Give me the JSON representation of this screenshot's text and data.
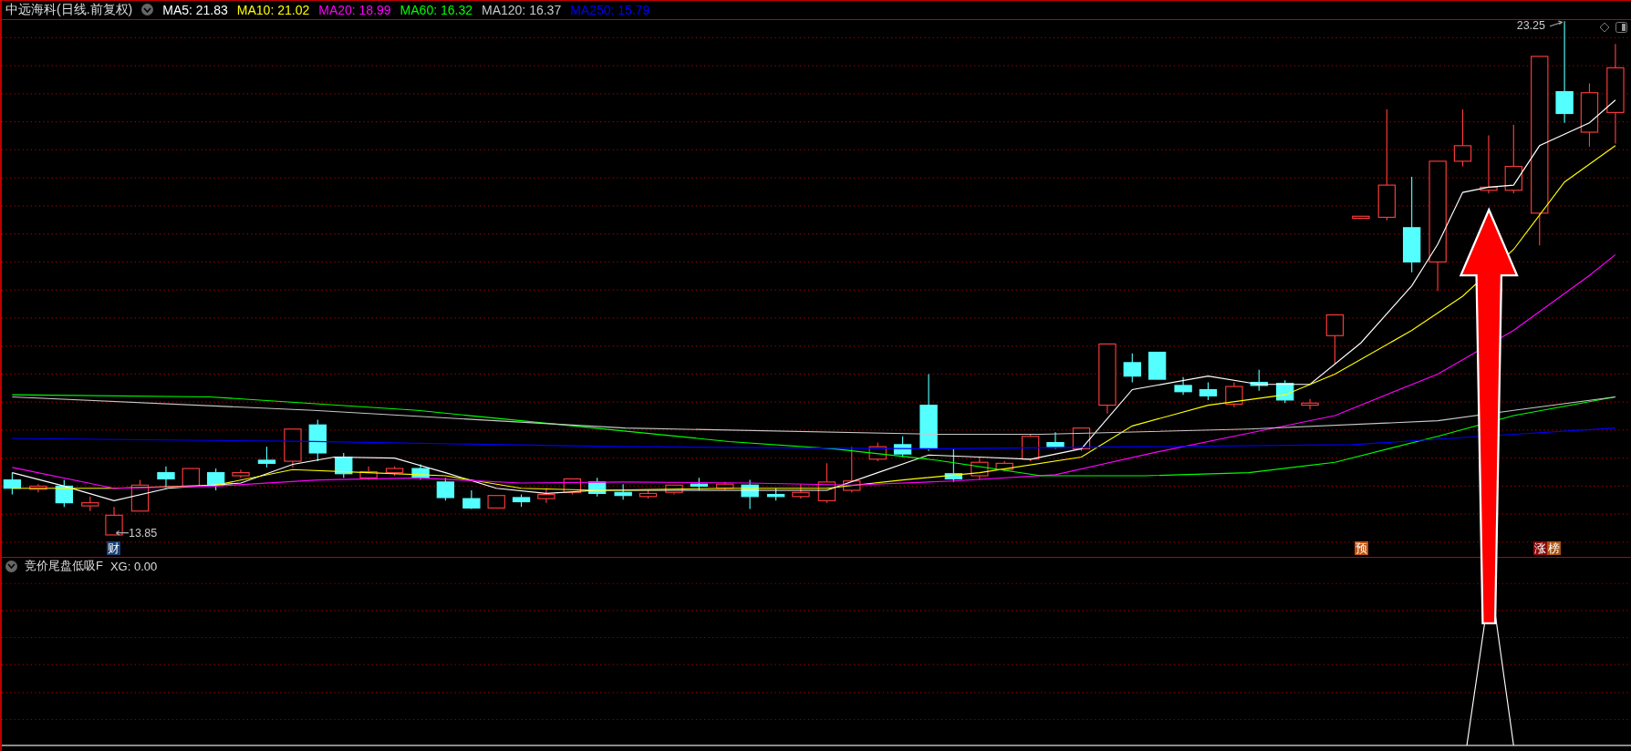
{
  "chart": {
    "title": "中远海科(日线.前复权)"
  },
  "moving_averages": [
    {
      "label": "MA5: 21.83",
      "color": "#ffffff"
    },
    {
      "label": "MA10: 21.02",
      "color": "#ffff00"
    },
    {
      "label": "MA20: 18.99",
      "color": "#ff00ff"
    },
    {
      "label": "MA60: 16.32",
      "color": "#00ff00"
    },
    {
      "label": "MA120: 16.37",
      "color": "#c8c8c8"
    },
    {
      "label": "MA250: 15.79",
      "color": "#0000ff"
    }
  ],
  "price_marks": [
    {
      "kind": "low",
      "text": "13.85"
    },
    {
      "kind": "high",
      "text": "23.25"
    }
  ],
  "event_tags": [
    {
      "text": "财",
      "color": "#1c3f73"
    },
    {
      "text": "预",
      "color": "#c0500f"
    },
    {
      "text": "涨",
      "color": "#8a0a0a"
    },
    {
      "text": "榜",
      "color": "#a8520f"
    }
  ],
  "indicator": {
    "title": "竞价尾盘低吸F",
    "reading": "XG: 0.00"
  }
}
